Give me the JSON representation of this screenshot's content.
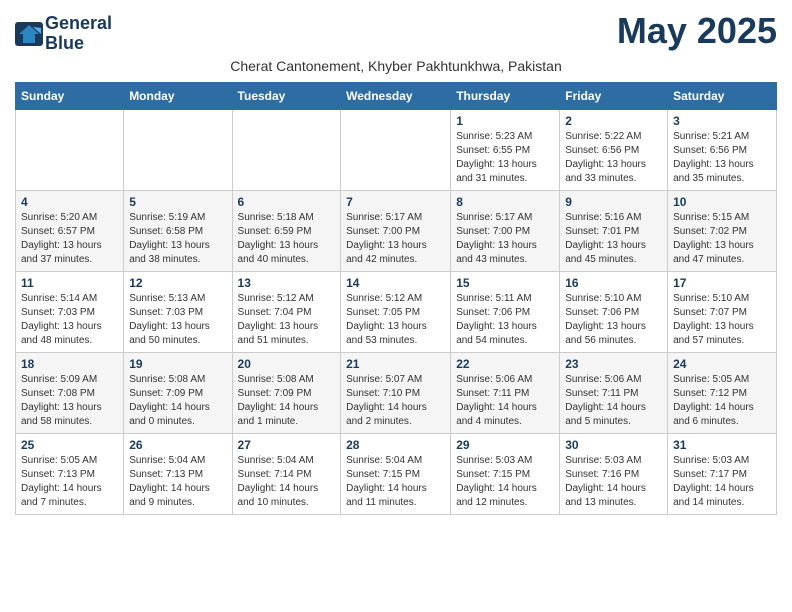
{
  "logo": {
    "line1": "General",
    "line2": "Blue"
  },
  "title": "May 2025",
  "subtitle": "Cherat Cantonement, Khyber Pakhtunkhwa, Pakistan",
  "headers": [
    "Sunday",
    "Monday",
    "Tuesday",
    "Wednesday",
    "Thursday",
    "Friday",
    "Saturday"
  ],
  "weeks": [
    [
      {
        "day": "",
        "info": ""
      },
      {
        "day": "",
        "info": ""
      },
      {
        "day": "",
        "info": ""
      },
      {
        "day": "",
        "info": ""
      },
      {
        "day": "1",
        "info": "Sunrise: 5:23 AM\nSunset: 6:55 PM\nDaylight: 13 hours\nand 31 minutes."
      },
      {
        "day": "2",
        "info": "Sunrise: 5:22 AM\nSunset: 6:56 PM\nDaylight: 13 hours\nand 33 minutes."
      },
      {
        "day": "3",
        "info": "Sunrise: 5:21 AM\nSunset: 6:56 PM\nDaylight: 13 hours\nand 35 minutes."
      }
    ],
    [
      {
        "day": "4",
        "info": "Sunrise: 5:20 AM\nSunset: 6:57 PM\nDaylight: 13 hours\nand 37 minutes."
      },
      {
        "day": "5",
        "info": "Sunrise: 5:19 AM\nSunset: 6:58 PM\nDaylight: 13 hours\nand 38 minutes."
      },
      {
        "day": "6",
        "info": "Sunrise: 5:18 AM\nSunset: 6:59 PM\nDaylight: 13 hours\nand 40 minutes."
      },
      {
        "day": "7",
        "info": "Sunrise: 5:17 AM\nSunset: 7:00 PM\nDaylight: 13 hours\nand 42 minutes."
      },
      {
        "day": "8",
        "info": "Sunrise: 5:17 AM\nSunset: 7:00 PM\nDaylight: 13 hours\nand 43 minutes."
      },
      {
        "day": "9",
        "info": "Sunrise: 5:16 AM\nSunset: 7:01 PM\nDaylight: 13 hours\nand 45 minutes."
      },
      {
        "day": "10",
        "info": "Sunrise: 5:15 AM\nSunset: 7:02 PM\nDaylight: 13 hours\nand 47 minutes."
      }
    ],
    [
      {
        "day": "11",
        "info": "Sunrise: 5:14 AM\nSunset: 7:03 PM\nDaylight: 13 hours\nand 48 minutes."
      },
      {
        "day": "12",
        "info": "Sunrise: 5:13 AM\nSunset: 7:03 PM\nDaylight: 13 hours\nand 50 minutes."
      },
      {
        "day": "13",
        "info": "Sunrise: 5:12 AM\nSunset: 7:04 PM\nDaylight: 13 hours\nand 51 minutes."
      },
      {
        "day": "14",
        "info": "Sunrise: 5:12 AM\nSunset: 7:05 PM\nDaylight: 13 hours\nand 53 minutes."
      },
      {
        "day": "15",
        "info": "Sunrise: 5:11 AM\nSunset: 7:06 PM\nDaylight: 13 hours\nand 54 minutes."
      },
      {
        "day": "16",
        "info": "Sunrise: 5:10 AM\nSunset: 7:06 PM\nDaylight: 13 hours\nand 56 minutes."
      },
      {
        "day": "17",
        "info": "Sunrise: 5:10 AM\nSunset: 7:07 PM\nDaylight: 13 hours\nand 57 minutes."
      }
    ],
    [
      {
        "day": "18",
        "info": "Sunrise: 5:09 AM\nSunset: 7:08 PM\nDaylight: 13 hours\nand 58 minutes."
      },
      {
        "day": "19",
        "info": "Sunrise: 5:08 AM\nSunset: 7:09 PM\nDaylight: 14 hours\nand 0 minutes."
      },
      {
        "day": "20",
        "info": "Sunrise: 5:08 AM\nSunset: 7:09 PM\nDaylight: 14 hours\nand 1 minute."
      },
      {
        "day": "21",
        "info": "Sunrise: 5:07 AM\nSunset: 7:10 PM\nDaylight: 14 hours\nand 2 minutes."
      },
      {
        "day": "22",
        "info": "Sunrise: 5:06 AM\nSunset: 7:11 PM\nDaylight: 14 hours\nand 4 minutes."
      },
      {
        "day": "23",
        "info": "Sunrise: 5:06 AM\nSunset: 7:11 PM\nDaylight: 14 hours\nand 5 minutes."
      },
      {
        "day": "24",
        "info": "Sunrise: 5:05 AM\nSunset: 7:12 PM\nDaylight: 14 hours\nand 6 minutes."
      }
    ],
    [
      {
        "day": "25",
        "info": "Sunrise: 5:05 AM\nSunset: 7:13 PM\nDaylight: 14 hours\nand 7 minutes."
      },
      {
        "day": "26",
        "info": "Sunrise: 5:04 AM\nSunset: 7:13 PM\nDaylight: 14 hours\nand 9 minutes."
      },
      {
        "day": "27",
        "info": "Sunrise: 5:04 AM\nSunset: 7:14 PM\nDaylight: 14 hours\nand 10 minutes."
      },
      {
        "day": "28",
        "info": "Sunrise: 5:04 AM\nSunset: 7:15 PM\nDaylight: 14 hours\nand 11 minutes."
      },
      {
        "day": "29",
        "info": "Sunrise: 5:03 AM\nSunset: 7:15 PM\nDaylight: 14 hours\nand 12 minutes."
      },
      {
        "day": "30",
        "info": "Sunrise: 5:03 AM\nSunset: 7:16 PM\nDaylight: 14 hours\nand 13 minutes."
      },
      {
        "day": "31",
        "info": "Sunrise: 5:03 AM\nSunset: 7:17 PM\nDaylight: 14 hours\nand 14 minutes."
      }
    ]
  ]
}
